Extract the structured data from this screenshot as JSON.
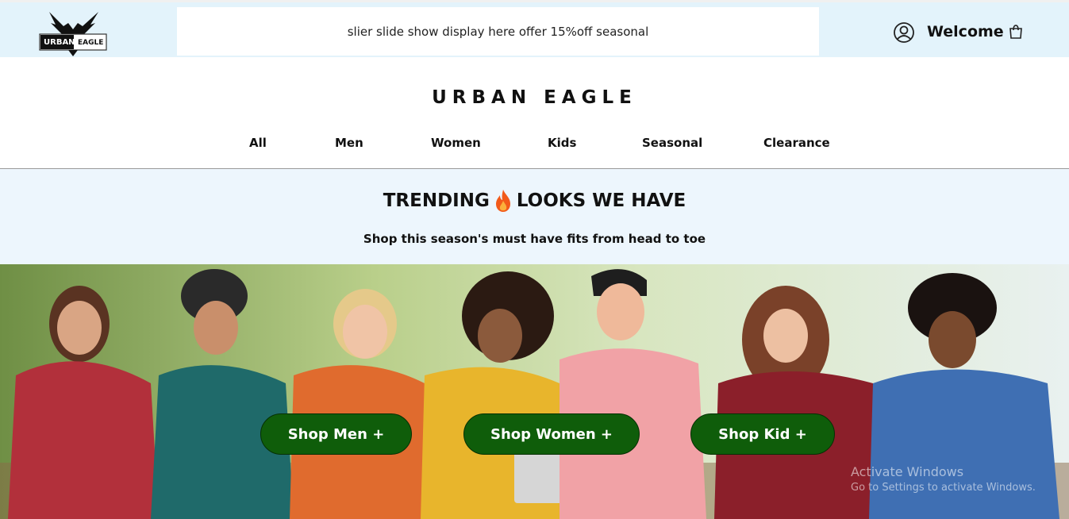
{
  "header": {
    "logo": {
      "line1": "URBAN",
      "line2": "EAGLE"
    },
    "slider_text": "slier slide show display here offer 15%off seasonal",
    "user_icon": "user-circle-icon",
    "welcome": "Welcome",
    "cart_icon": "shopping-bag-icon"
  },
  "brand": "URBAN EAGLE",
  "nav": [
    "All",
    "Men",
    "Women",
    "Kids",
    "Seasonal",
    "Clearance"
  ],
  "trending": {
    "title_left": "TRENDING",
    "icon": "fire-icon",
    "title_right": "LOOKS WE HAVE",
    "subtitle": "Shop this season's must have fits from head to toe"
  },
  "hero": {
    "buttons": [
      "Shop Men +",
      "Shop Women +",
      "Shop Kid +"
    ]
  },
  "watermark": {
    "line1": "Activate Windows",
    "line2": "Go to Settings to activate Windows."
  },
  "colors": {
    "topbar": "#e3f3fb",
    "band": "#edf6fd",
    "button": "#0f5d0a"
  }
}
